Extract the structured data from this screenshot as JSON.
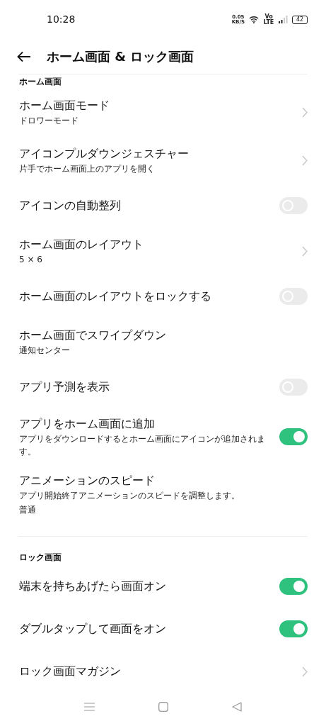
{
  "status_bar": {
    "time": "10:28",
    "speed_value": "0.05",
    "speed_unit": "KB/S",
    "network_label": "Vo LTE",
    "battery": "42"
  },
  "header": {
    "title": "ホーム画面 & ロック画面"
  },
  "sections": [
    {
      "heading": "ホーム画面",
      "items": [
        {
          "kind": "chevron",
          "title": "ホーム画面モード",
          "subtitle": "ドロワーモード"
        },
        {
          "kind": "chevron",
          "title": "アイコンプルダウンジェスチャー",
          "subtitle": "片手でホーム画面上のアプリを開く"
        },
        {
          "kind": "toggle",
          "title": "アイコンの自動整列",
          "on": false
        },
        {
          "kind": "chevron",
          "title": "ホーム画面のレイアウト",
          "subtitle": "5 × 6"
        },
        {
          "kind": "toggle",
          "title": "ホーム画面のレイアウトをロックする",
          "on": false
        },
        {
          "kind": "plain",
          "title": "ホーム画面でスワイプダウン",
          "subtitle": "通知センター"
        },
        {
          "kind": "toggle",
          "title": "アプリ予測を表示",
          "on": false
        },
        {
          "kind": "toggle",
          "title": "アプリをホーム画面に追加",
          "subtitle": "アプリをダウンロードするとホーム画面にアイコンが追加されます。",
          "on": true
        },
        {
          "kind": "plain",
          "title": "アニメーションのスピード",
          "subtitle": "アプリ開始終了アニメーションのスピードを調整します。",
          "value": "普通"
        }
      ]
    },
    {
      "heading": "ロック画面",
      "items": [
        {
          "kind": "toggle",
          "title": "端末を持ちあげたら画面オン",
          "on": true
        },
        {
          "kind": "toggle",
          "title": "ダブルタップして画面をオン",
          "on": true
        },
        {
          "kind": "chevron",
          "title": "ロック画面マガジン"
        }
      ]
    }
  ]
}
